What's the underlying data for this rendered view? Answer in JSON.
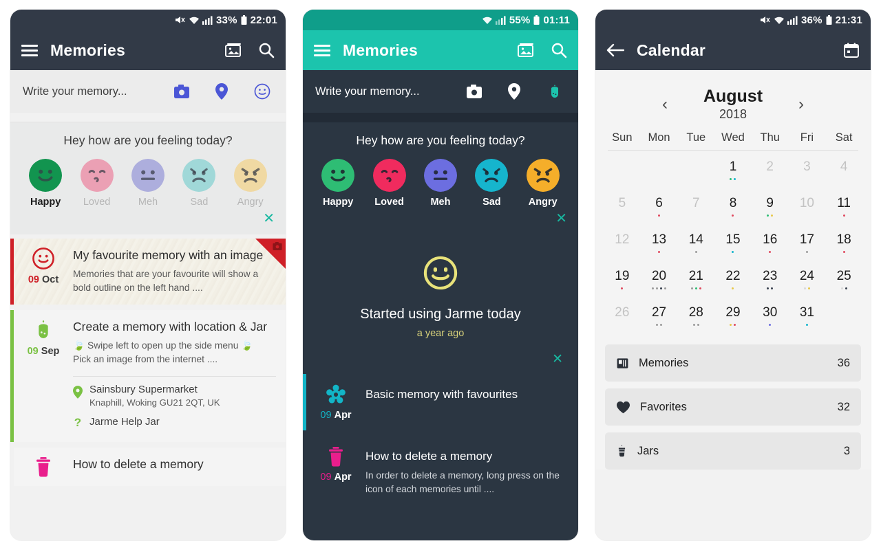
{
  "theme": {
    "dark_nav": "#323a47",
    "teal": "#1cc4ad",
    "teal_dark": "#0f9e8a",
    "dark_bg": "#2b3642",
    "light_bg": "#f1f1f1",
    "accent_close": "#18b8a0",
    "favourite_red": "#cf2027",
    "pink": "#e91e8c"
  },
  "phone1": {
    "status": {
      "battery": "33%",
      "time": "22:01",
      "icons": [
        "mute-icon",
        "wifi-icon",
        "signal-icon",
        "battery-icon"
      ]
    },
    "toolbar": {
      "menu": "menu-icon",
      "title": "Memories",
      "gallery": "gallery-icon",
      "search": "search-icon"
    },
    "composer": {
      "placeholder": "Write your memory...",
      "actions": [
        "camera-icon",
        "location-icon",
        "mood-icon"
      ]
    },
    "mood": {
      "question": "Hey how are you feeling today?",
      "close": "✕",
      "selected": "Happy",
      "items": [
        {
          "label": "Happy",
          "color": "#12944f",
          "face": "happy"
        },
        {
          "label": "Loved",
          "color": "#eba0b4",
          "face": "loved"
        },
        {
          "label": "Meh",
          "color": "#adaedd",
          "face": "meh"
        },
        {
          "label": "Sad",
          "color": "#a0d8d8",
          "face": "sad"
        },
        {
          "label": "Angry",
          "color": "#f0d9a3",
          "face": "angry"
        }
      ]
    },
    "cards": [
      {
        "day": "09",
        "month": "Oct",
        "accent": "#cf2027",
        "icon": "smiley-outline-icon",
        "title": "My favourite memory with an image",
        "text": "Memories that are your favourite will show a bold outline on the left hand ....",
        "favourite_ribbon": true,
        "ribbon_icon": "camera-icon",
        "has_image": true
      },
      {
        "day": "09",
        "month": "Sep",
        "accent": "#7ac143",
        "icon": "jar-icon",
        "title": "Create a memory with location & Jar",
        "text": "🍃 Swipe left to open up the side menu 🍃\nPick an image from the internet ....",
        "location_title": "Sainsbury Supermarket",
        "location_sub": "Knaphill, Woking GU21 2QT, UK",
        "jar_label": "Jarme Help Jar",
        "has_image": false
      },
      {
        "day": "",
        "month": "",
        "accent": "#f1f1f1",
        "icon": "trash-icon",
        "title": "How to delete a memory",
        "text": "",
        "has_image": false
      }
    ]
  },
  "phone2": {
    "status": {
      "battery": "55%",
      "time": "01:11",
      "icons": [
        "wifi-icon",
        "signal-icon",
        "battery-icon"
      ]
    },
    "toolbar": {
      "menu": "menu-icon",
      "title": "Memories",
      "gallery": "gallery-icon",
      "search": "search-icon"
    },
    "composer": {
      "placeholder": "Write your memory...",
      "actions": [
        "camera-icon",
        "location-icon",
        "jar-icon"
      ]
    },
    "mood": {
      "question": "Hey how are you feeling today?",
      "close": "✕",
      "items": [
        {
          "label": "Happy",
          "color": "#2ebd74",
          "face": "happy"
        },
        {
          "label": "Loved",
          "color": "#f02b5e",
          "face": "loved"
        },
        {
          "label": "Meh",
          "color": "#6c6ee0",
          "face": "meh"
        },
        {
          "label": "Sad",
          "color": "#16b5cd",
          "face": "sad"
        },
        {
          "label": "Angry",
          "color": "#f5ae2a",
          "face": "angry"
        }
      ]
    },
    "hero": {
      "icon": "smiley-outline-icon",
      "icon_color": "#e8e27a",
      "title": "Started using Jarme today",
      "subtitle": "a year ago",
      "close": "✕"
    },
    "cards": [
      {
        "day": "09",
        "month": "Apr",
        "accent": "#12b5c7",
        "icon": "flower-icon",
        "title": "Basic memory with favourites",
        "text": ""
      },
      {
        "day": "09",
        "month": "Apr",
        "accent": "#2b3642",
        "icon": "trash-icon",
        "icon_color": "#e91e8c",
        "title": "How to delete a memory",
        "text": "In order to delete a memory, long press on the icon of each memories until ...."
      }
    ]
  },
  "phone3": {
    "status": {
      "battery": "36%",
      "time": "21:31",
      "icons": [
        "mute-icon",
        "wifi-icon",
        "signal-icon",
        "battery-icon"
      ]
    },
    "toolbar": {
      "back": "back-arrow-icon",
      "title": "Calendar",
      "calendar": "calendar-icon"
    },
    "calendar": {
      "month": "August",
      "year": "2018",
      "prev": "‹",
      "next": "›",
      "day_names": [
        "Sun",
        "Mon",
        "Tue",
        "Wed",
        "Thu",
        "Fri",
        "Sat"
      ],
      "weeks": [
        [
          {
            "n": "",
            "muted": true,
            "dots": []
          },
          {
            "n": "",
            "muted": true,
            "dots": []
          },
          {
            "n": "",
            "muted": true,
            "dots": []
          },
          {
            "n": "1",
            "muted": false,
            "dots": [
              "#2ebd74",
              "#16b5cd"
            ]
          },
          {
            "n": "2",
            "muted": true,
            "dots": []
          },
          {
            "n": "3",
            "muted": true,
            "dots": []
          },
          {
            "n": "4",
            "muted": true,
            "dots": []
          }
        ],
        [
          {
            "n": "5",
            "muted": true,
            "dots": []
          },
          {
            "n": "6",
            "muted": false,
            "dots": [
              "#e04a5f"
            ]
          },
          {
            "n": "7",
            "muted": true,
            "dots": []
          },
          {
            "n": "8",
            "muted": false,
            "dots": [
              "#e04a5f"
            ]
          },
          {
            "n": "9",
            "muted": false,
            "dots": [
              "#2ebd74",
              "#e8c84a"
            ]
          },
          {
            "n": "10",
            "muted": true,
            "dots": []
          },
          {
            "n": "11",
            "muted": false,
            "dots": [
              "#e04a5f"
            ]
          }
        ],
        [
          {
            "n": "12",
            "muted": true,
            "dots": []
          },
          {
            "n": "13",
            "muted": false,
            "dots": [
              "#e04a5f"
            ]
          },
          {
            "n": "14",
            "muted": false,
            "dots": [
              "#9b9b9b"
            ]
          },
          {
            "n": "15",
            "muted": false,
            "dots": [
              "#16b5cd"
            ]
          },
          {
            "n": "16",
            "muted": false,
            "dots": [
              "#e04a5f"
            ]
          },
          {
            "n": "17",
            "muted": false,
            "dots": [
              "#9b9b9b"
            ]
          },
          {
            "n": "18",
            "muted": false,
            "dots": [
              "#e04a5f"
            ]
          }
        ],
        [
          {
            "n": "19",
            "muted": false,
            "dots": [
              "#e04a5f"
            ]
          },
          {
            "n": "20",
            "muted": false,
            "dots": [
              "#9b9b9b",
              "#9b9b9b",
              "#3b4350",
              "#9b9b9b"
            ]
          },
          {
            "n": "21",
            "muted": false,
            "dots": [
              "#9b9b9b",
              "#2ebd74",
              "#e04a5f"
            ]
          },
          {
            "n": "22",
            "muted": false,
            "dots": [
              "#e8c84a"
            ]
          },
          {
            "n": "23",
            "muted": false,
            "dots": [
              "#3b4350",
              "#3b4350"
            ]
          },
          {
            "n": "24",
            "muted": false,
            "dots": [
              "#d9d9d9",
              "#e8c84a"
            ]
          },
          {
            "n": "25",
            "muted": false,
            "dots": [
              "#d9d9d9",
              "#3b4350"
            ]
          }
        ],
        [
          {
            "n": "26",
            "muted": true,
            "dots": []
          },
          {
            "n": "27",
            "muted": false,
            "dots": [
              "#9b9b9b",
              "#9b9b9b"
            ]
          },
          {
            "n": "28",
            "muted": false,
            "dots": [
              "#9b9b9b",
              "#9b9b9b"
            ]
          },
          {
            "n": "29",
            "muted": false,
            "dots": [
              "#e8c84a",
              "#e04a5f"
            ]
          },
          {
            "n": "30",
            "muted": false,
            "dots": [
              "#6c6ee0"
            ]
          },
          {
            "n": "31",
            "muted": false,
            "dots": [
              "#16b5cd"
            ]
          },
          {
            "n": "",
            "muted": true,
            "dots": []
          }
        ]
      ]
    },
    "stats": [
      {
        "icon": "book-icon",
        "label": "Memories",
        "value": "36"
      },
      {
        "icon": "heart-icon",
        "label": "Favorites",
        "value": "32"
      },
      {
        "icon": "jar-icon",
        "label": "Jars",
        "value": "3"
      }
    ]
  }
}
